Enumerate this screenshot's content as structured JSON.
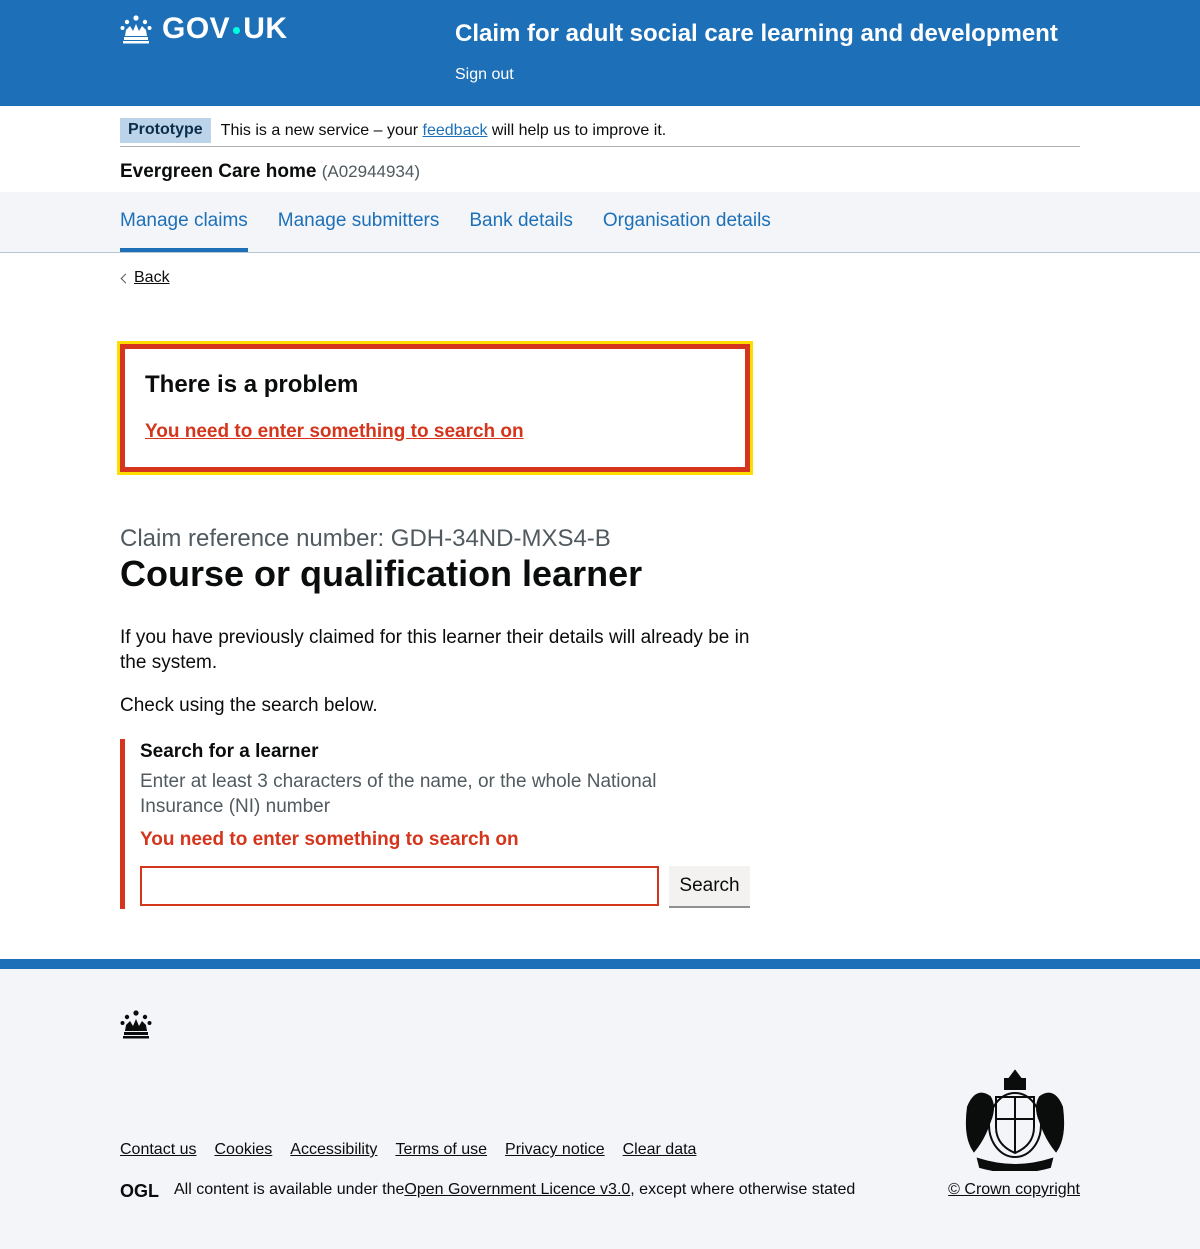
{
  "header": {
    "logo_text_a": "GOV",
    "logo_text_b": "UK",
    "service_name": "Claim for adult social care learning and development",
    "sign_out": "Sign out"
  },
  "phase_banner": {
    "tag": "Prototype",
    "text_before": "This is a new service – your ",
    "link": "feedback",
    "text_after": " will help us to improve it."
  },
  "organisation": {
    "name": "Evergreen Care home",
    "id": "(A02944934)"
  },
  "subnav": {
    "items": [
      {
        "label": "Manage claims",
        "active": true
      },
      {
        "label": "Manage submitters",
        "active": false
      },
      {
        "label": "Bank details",
        "active": false
      },
      {
        "label": "Organisation details",
        "active": false
      }
    ]
  },
  "back_link": "Back",
  "error_summary": {
    "title": "There is a problem",
    "error_link": "You need to enter something to search on"
  },
  "caption": "Claim reference number: GDH-34ND-MXS4-B",
  "title": "Course or qualification learner",
  "paragraphs": [
    "If you have previously claimed for this learner their details will already be in the system.",
    "Check using the search below."
  ],
  "search": {
    "label": "Search for a learner",
    "hint": "Enter at least 3 characters of the name, or the whole National Insurance (NI) number",
    "error": "You need to enter something to search on",
    "value": "",
    "button": "Search"
  },
  "footer": {
    "links": [
      "Contact us",
      "Cookies",
      "Accessibility",
      "Terms of use",
      "Privacy notice",
      "Clear data"
    ],
    "licence_before": "All content is available under the ",
    "licence_link": "Open Government Licence v3.0",
    "licence_after": ", except where otherwise stated",
    "copyright": "© Crown copyright",
    "ogl_logo": "OGL"
  },
  "colors": {
    "brand_blue": "#1d70b8",
    "error_red": "#d4351c",
    "focus_yellow": "#ffdd00"
  }
}
